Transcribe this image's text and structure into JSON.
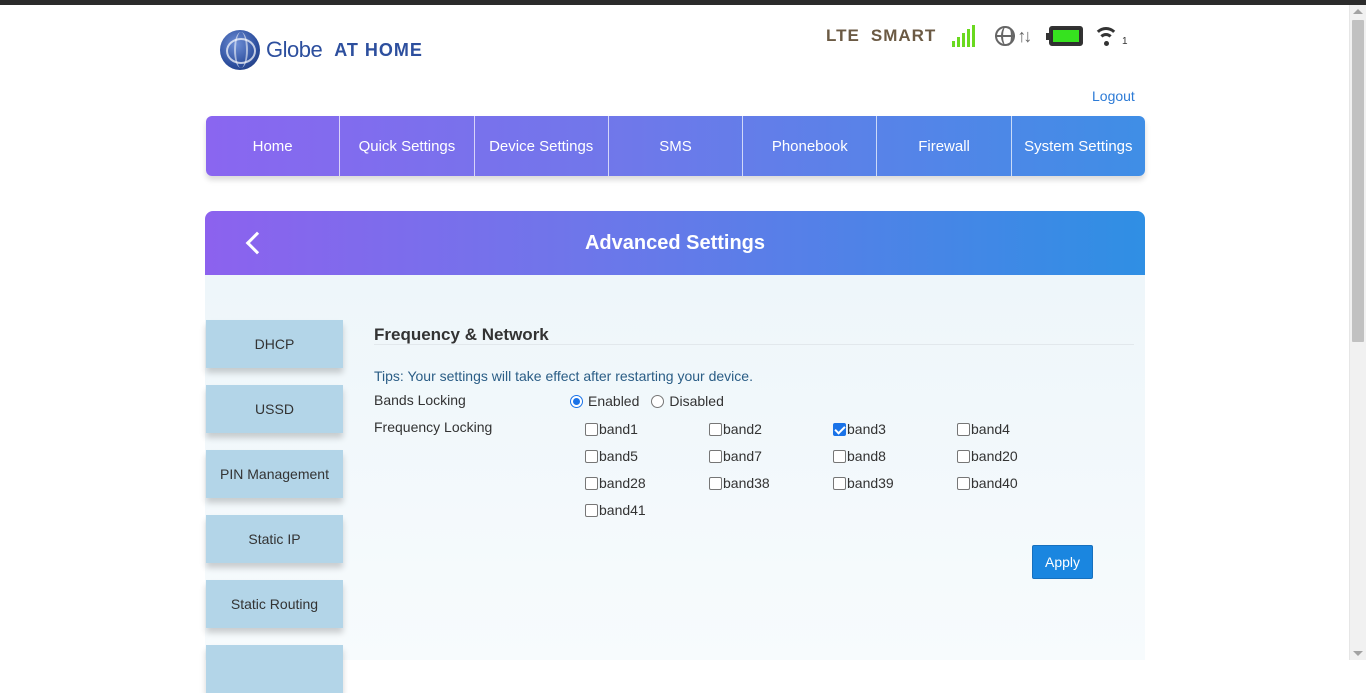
{
  "brand": {
    "name": "Globe",
    "tagline": "AT HOME"
  },
  "status": {
    "network_type": "LTE",
    "operator": "SMART",
    "signal_bars": 5,
    "data_icon": "globe-icon",
    "transfer_icon": "arrows-up-down-icon",
    "battery_level": 1.0,
    "battery_color": "#36e21f",
    "wifi_clients": "1"
  },
  "logout_label": "Logout",
  "nav": {
    "items": [
      {
        "label": "Home"
      },
      {
        "label": "Quick Settings"
      },
      {
        "label": "Device Settings"
      },
      {
        "label": "SMS"
      },
      {
        "label": "Phonebook"
      },
      {
        "label": "Firewall"
      },
      {
        "label": "System Settings"
      }
    ]
  },
  "page": {
    "title": "Advanced Settings"
  },
  "sidebar": {
    "items": [
      {
        "label": "DHCP"
      },
      {
        "label": "USSD"
      },
      {
        "label": "PIN Management"
      },
      {
        "label": "Static IP"
      },
      {
        "label": "Static Routing"
      }
    ]
  },
  "section": {
    "title": "Frequency & Network",
    "tips": "Tips: Your settings will take effect after restarting your device.",
    "bands_locking_label": "Bands Locking",
    "bands_locking_options": [
      {
        "label": "Enabled",
        "selected": true
      },
      {
        "label": "Disabled",
        "selected": false
      }
    ],
    "frequency_locking_label": "Frequency Locking",
    "bands": [
      {
        "label": "band1",
        "checked": false
      },
      {
        "label": "band2",
        "checked": false
      },
      {
        "label": "band3",
        "checked": true
      },
      {
        "label": "band4",
        "checked": false
      },
      {
        "label": "band5",
        "checked": false
      },
      {
        "label": "band7",
        "checked": false
      },
      {
        "label": "band8",
        "checked": false
      },
      {
        "label": "band20",
        "checked": false
      },
      {
        "label": "band28",
        "checked": false
      },
      {
        "label": "band38",
        "checked": false
      },
      {
        "label": "band39",
        "checked": false
      },
      {
        "label": "band40",
        "checked": false
      },
      {
        "label": "band41",
        "checked": false
      }
    ],
    "apply_label": "Apply"
  },
  "colors": {
    "accent": "#1a86e0",
    "nav_gradient_start": "#8a66f0",
    "nav_gradient_end": "#3f8ee6",
    "sidebar_button": "#b3d5e8"
  }
}
